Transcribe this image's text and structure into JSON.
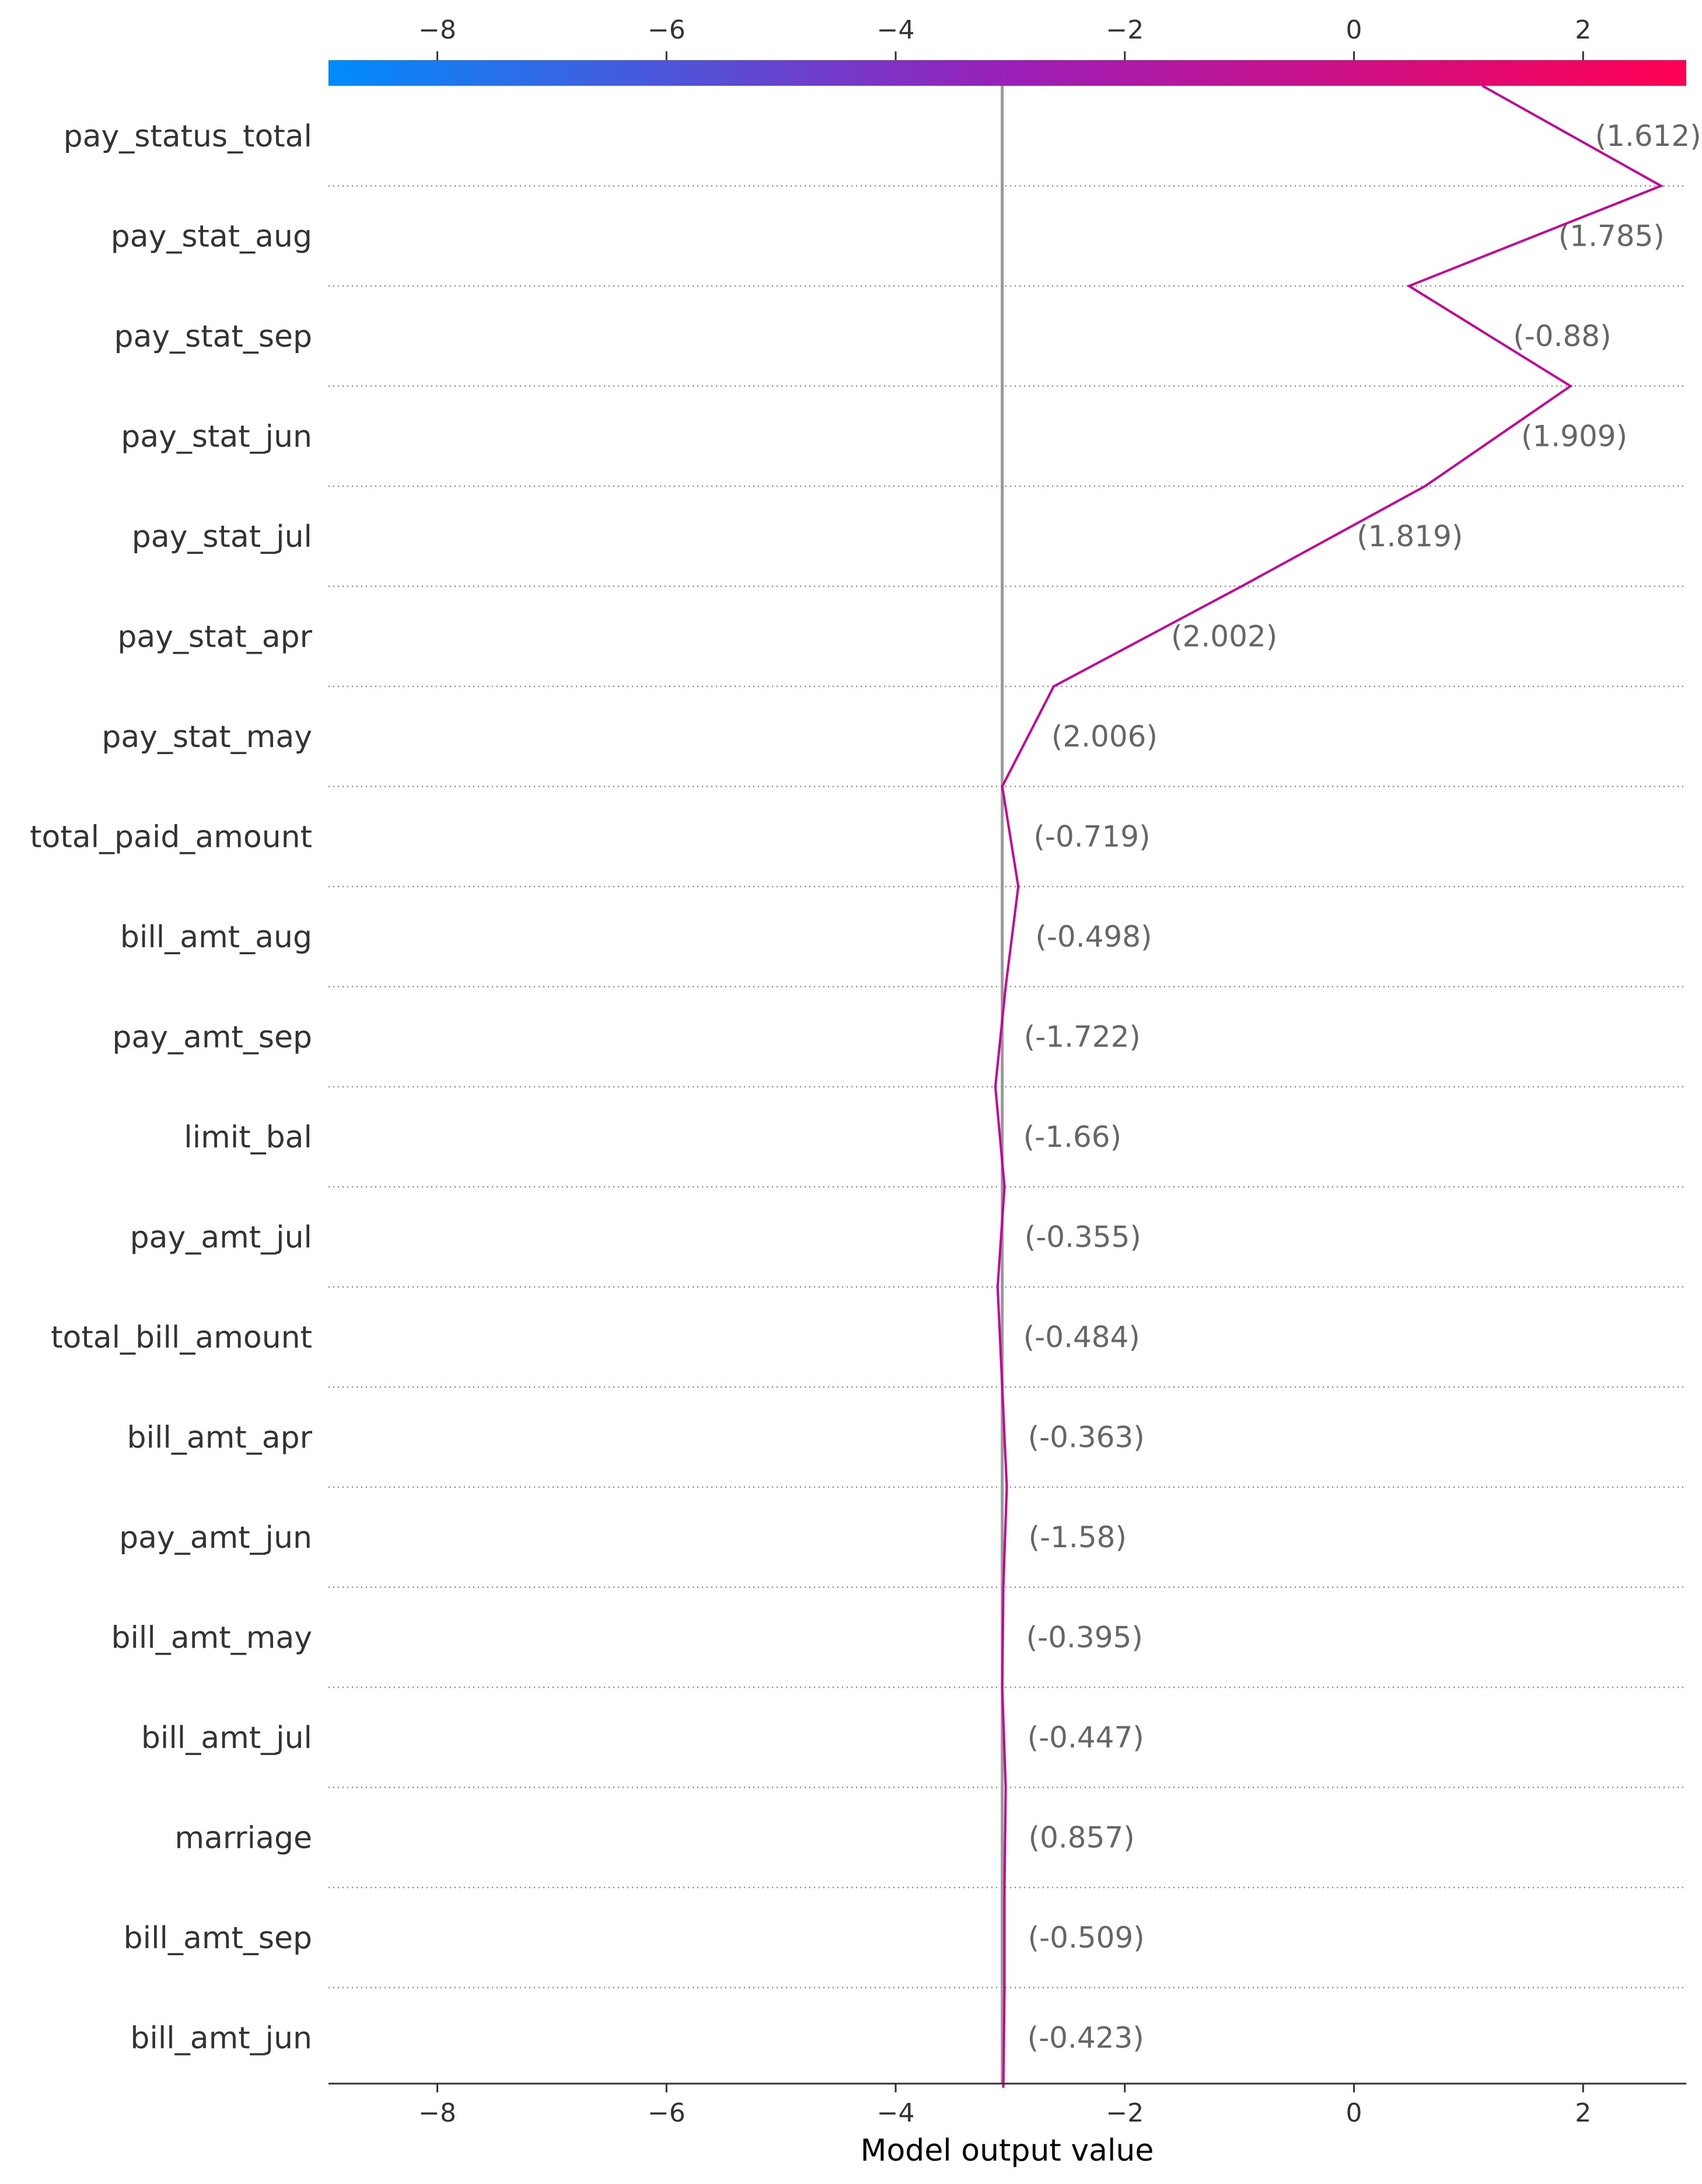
{
  "chart_data": {
    "type": "decision_plot",
    "xlabel": "Model output value",
    "xlim": [
      -8.95,
      2.9
    ],
    "xticks": [
      -8,
      -6,
      -4,
      -2,
      0,
      2
    ],
    "xtick_labels": [
      "−8",
      "−6",
      "−4",
      "−2",
      "0",
      "2"
    ],
    "base_value": -3.07,
    "colormap": [
      "#008bfb",
      "#ff0052"
    ],
    "line_color": "#c80098",
    "base_line_color": "#999999",
    "features": [
      {
        "name": "pay_status_total",
        "value_label": "(1.612)"
      },
      {
        "name": "pay_stat_aug",
        "value_label": "(1.785)"
      },
      {
        "name": "pay_stat_sep",
        "value_label": "(-0.88)"
      },
      {
        "name": "pay_stat_jun",
        "value_label": "(1.909)"
      },
      {
        "name": "pay_stat_jul",
        "value_label": "(1.819)"
      },
      {
        "name": "pay_stat_apr",
        "value_label": "(2.002)"
      },
      {
        "name": "pay_stat_may",
        "value_label": "(2.006)"
      },
      {
        "name": "total_paid_amount",
        "value_label": "(-0.719)"
      },
      {
        "name": "bill_amt_aug",
        "value_label": "(-0.498)"
      },
      {
        "name": "pay_amt_sep",
        "value_label": "(-1.722)"
      },
      {
        "name": "limit_bal",
        "value_label": "(-1.66)"
      },
      {
        "name": "pay_amt_jul",
        "value_label": "(-0.355)"
      },
      {
        "name": "total_bill_amount",
        "value_label": "(-0.484)"
      },
      {
        "name": "bill_amt_apr",
        "value_label": "(-0.363)"
      },
      {
        "name": "pay_amt_jun",
        "value_label": "(-1.58)"
      },
      {
        "name": "bill_amt_may",
        "value_label": "(-0.395)"
      },
      {
        "name": "bill_amt_jul",
        "value_label": "(-0.447)"
      },
      {
        "name": "marriage",
        "value_label": "(0.857)"
      },
      {
        "name": "bill_amt_sep",
        "value_label": "(-0.509)"
      },
      {
        "name": "bill_amt_jun",
        "value_label": "(-0.423)"
      }
    ],
    "path_values": [
      1.12,
      2.68,
      0.48,
      1.89,
      0.62,
      -0.98,
      -2.62,
      -3.07,
      -2.93,
      -3.04,
      -3.13,
      -3.05,
      -3.11,
      -3.07,
      -3.03,
      -3.06,
      -3.07,
      -3.04,
      -3.05,
      -3.05,
      -3.06
    ]
  }
}
